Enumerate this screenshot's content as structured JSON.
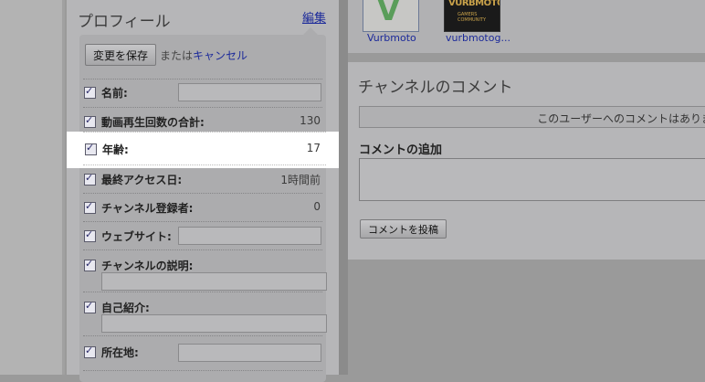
{
  "profile": {
    "title": "プロフィール",
    "edit_link": "編集",
    "save_button": "変更を保存",
    "or_text": "または",
    "cancel_link": "キャンセル",
    "fields": [
      {
        "label": "名前:",
        "value": ""
      },
      {
        "label": "動画再生回数の合計:",
        "value": "130"
      },
      {
        "label": "年齢:",
        "value": "17"
      },
      {
        "label": "最終アクセス日:",
        "value": "1時間前"
      },
      {
        "label": "チャンネル登録者:",
        "value": "0"
      },
      {
        "label": "ウェブサイト:",
        "value": ""
      },
      {
        "label": "チャンネルの説明:",
        "value": ""
      },
      {
        "label": "自己紹介:",
        "value": ""
      },
      {
        "label": "所在地:",
        "value": ""
      }
    ]
  },
  "friends": [
    {
      "name": "Vurbmoto",
      "thumb_text": "V"
    },
    {
      "name": "vurbmotog...",
      "thumb_text": "VURBMOTO",
      "thumb_subtext": "GAMERS COMMUNITY"
    }
  ],
  "comments": {
    "title": "チャンネルのコメント",
    "empty_message": "このユーザーへのコメントはありま",
    "add_title": "コメントの追加",
    "post_button": "コメントを投稿"
  },
  "colors": {
    "link": "#1c2a9a",
    "highlight": "#ffffff",
    "panel": "#b6b6b8"
  }
}
